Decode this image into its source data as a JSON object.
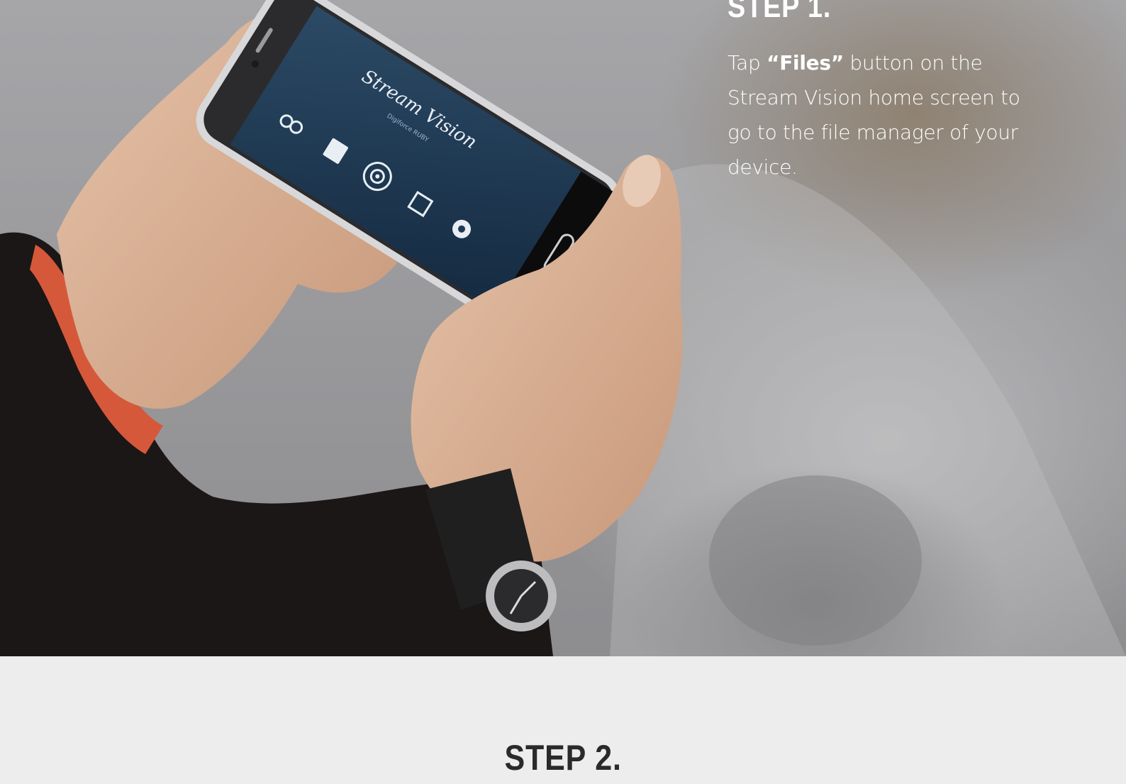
{
  "step1": {
    "title": "STEP 1.",
    "text_before": "Tap ",
    "text_bold": "“Files”",
    "text_after": " button on the Stream Vision home screen to go to the file manager of your device."
  },
  "phone_screen": {
    "app_title": "Stream Vision",
    "subtitle": "Digiforce RUBY",
    "menu": [
      "Multilenses",
      "Files",
      "Viewfinder",
      "Stream",
      "Settings"
    ]
  },
  "step2": {
    "title": "STEP 2."
  }
}
